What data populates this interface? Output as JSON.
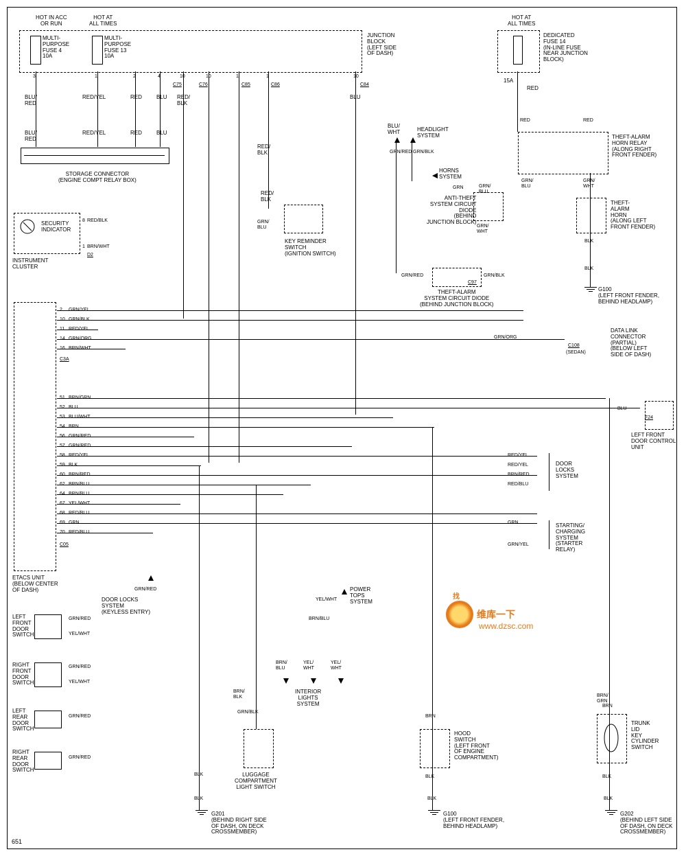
{
  "header": {
    "hot_acc": "HOT IN ACC\nOR RUN",
    "hot_all": "HOT AT\nALL TIMES",
    "hot_all2": "HOT AT\nALL TIMES"
  },
  "fuses": {
    "mp4": "MULTI-\nPURPOSE\nFUSE 4\n10A",
    "mp13": "MULTI-\nPURPOSE\nFUSE 13\n10A",
    "dedicated": "DEDICATED\nFUSE 14\n(IN-LINE FUSE\nNEAR JUNCTION\nBLOCK)",
    "dedicated_val": "15A"
  },
  "blocks": {
    "junction": "JUNCTION\nBLOCK\n(LEFT SIDE\nOF DASH)",
    "storage": "STORAGE CONNECTOR\n(ENGINE COMPT RELAY BOX)",
    "security": "SECURITY\nINDICATOR",
    "instrument": "INSTRUMENT\nCLUSTER",
    "key_reminder": "KEY REMINDER\nSWITCH\n(IGNITION SWITCH)",
    "headlight": "HEADLIGHT\nSYSTEM",
    "horns": "HORNS\nSYSTEM",
    "anti_theft_diode": "ANTI-THEFT\nSYSTEM CIRCUIT\nDIODE\n(BEHIND\nJUNCTION BLOCK)",
    "theft_relay": "THEFT-ALARM\nHORN RELAY\n(ALONG RIGHT\nFRONT FENDER)",
    "theft_horn": "THEFT-\nALARM\nHORN\n(ALONG LEFT\nFRONT FENDER)",
    "theft_diode2": "THEFT-ALARM\nSYSTEM CIRCUIT DIODE\n(BEHIND JUNCTION BLOCK)",
    "datalink": "DATA LINK\nCONNECTOR\n(PARTIAL)\n(BELOW LEFT\nSIDE OF DASH)",
    "lfdoor_unit": "LEFT FRONT\nDOOR CONTROL\nUNIT",
    "doorlocks": "DOOR\nLOCKS\nSYSTEM",
    "starting": "STARTING/\nCHARGING\nSYSTEM\n(STARTER\nRELAY)",
    "etacs": "ETACS UNIT\n(BELOW CENTER\nOF DASH)",
    "doorlocks_keyless": "DOOR LOCKS\nSYSTEM\n(KEYLESS ENTRY)",
    "powertops": "POWER\nTOPS\nSYSTEM",
    "interior_lights": "INTERIOR\nLIGHTS\nSYSTEM",
    "luggage": "LUGGAGE\nCOMPARTMENT\nLIGHT SWITCH",
    "hood": "HOOD\nSWITCH\n(LEFT FRONT\nOF ENGINE\nCOMPARTMENT)",
    "trunk": "TRUNK\nLID\nKEY\nCYLINDER\nSWITCH"
  },
  "switches": {
    "lf": "LEFT\nFRONT\nDOOR\nSWITCH",
    "rf": "RIGHT\nFRONT\nDOOR\nSWITCH",
    "lr": "LEFT\nREAR\nDOOR\nSWITCH",
    "rr": "RIGHT\nREAR\nDOOR\nSWITCH"
  },
  "grounds": {
    "g100": "G100\n(LEFT FRONT FENDER,\nBEHIND HEADLAMP)",
    "g201": "G201\n(BEHIND RIGHT SIDE\nOF DASH, ON DECK\nCROSSMEMBER)",
    "g100b": "G100\n(LEFT FRONT FENDER,\nBEHIND HEADLAMP)",
    "g202": "G202\n(BEHIND LEFT SIDE\nOF DASH, ON DECK\nCROSSMEMBER)"
  },
  "wires": {
    "blu_red": "BLU/\nRED",
    "red_yel": "RED/YEL",
    "red": "RED",
    "blu": "BLU",
    "red_blk": "RED/\nBLK",
    "blu_wht": "BLU/\nWHT",
    "grn_red": "GRN/RED",
    "grn_blk": "GRN/BLK",
    "grn": "GRN",
    "grn_blu": "GRN/\nBLU",
    "grn_wht": "GRN/\nWHT",
    "blk": "BLK",
    "brn_wht": "BRN/WHT",
    "grn_yel": "GRN/YEL",
    "grn_org": "GRN/ORG",
    "brn_grn": "BRN/GRN",
    "brn": "BRN",
    "brn_red": "BRN/RED",
    "brn_blu": "BRN/BLU",
    "yel_wht": "YEL/WHT",
    "red_blu": "RED/BLU",
    "brn_blk": "BRN/\nBLK",
    "brn_grn2": "BRN/\nGRN",
    "yel_wht2": "YEL/\nWHT",
    "brn_blu2": "BRN/\nBLU"
  },
  "connectors": {
    "c75": "C75",
    "c76": "C76",
    "c85": "C85",
    "c86": "C86",
    "c84": "C84",
    "c97": "C97",
    "c108": "C108",
    "sedan": "(SEDAN)",
    "c3a": "C3A",
    "c05": "C05",
    "d2": "D2",
    "f24": "F24"
  },
  "etacs_pins": {
    "p2": "2",
    "p10": "10",
    "p11": "11",
    "p14": "14",
    "p16": "16",
    "p51": "51",
    "p52": "52",
    "p53": "53",
    "p54": "54",
    "p56": "56",
    "p57": "57",
    "p58": "58",
    "p59": "59",
    "p60": "60",
    "p62": "62",
    "p64": "64",
    "p67": "67",
    "p68": "68",
    "p69": "69",
    "p70": "70"
  },
  "etacs_wires": {
    "w2": "GRN/YEL",
    "w10": "GRN/BLK",
    "w11": "RED/YEL",
    "w14": "GRN/ORG",
    "w16": "BRN/WHT",
    "w51": "BRN/GRN",
    "w52": "BLU",
    "w53": "BLU/WHT",
    "w54": "BRN",
    "w56": "GRN/RED",
    "w57": "GRN/RED",
    "w58": "RED/YEL",
    "w59": "BLK",
    "w60": "BRN/RED",
    "w62": "BRN/BLU",
    "w64": "BRN/BLU",
    "w67": "YEL/WHT",
    "w68": "RED/BLU",
    "w69": "GRN",
    "w70": "RED/BLU"
  },
  "misc": {
    "page": "651",
    "red_blk8": "RED/BLK",
    "e": "8",
    "one": "1",
    "two": "2",
    "three": "3",
    "four": "4",
    "ten": "10"
  },
  "watermark": {
    "text": "维库一下",
    "url": "www.dzsc.com",
    "prefix": "找"
  }
}
